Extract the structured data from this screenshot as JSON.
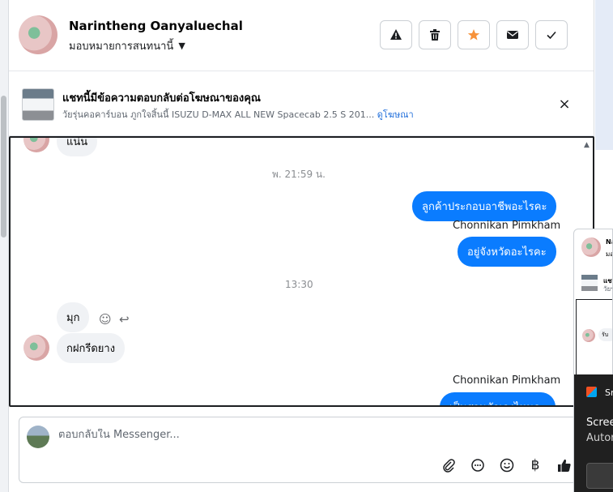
{
  "header": {
    "contact_name": "Narintheng Oanyaluechal",
    "assign_label": "มอบหมายการสนทนานี้",
    "buttons": [
      {
        "name": "report-button",
        "icon": "warning-icon"
      },
      {
        "name": "delete-button",
        "icon": "trash-icon"
      },
      {
        "name": "star-button",
        "icon": "star-icon",
        "color": "#f7923a"
      },
      {
        "name": "mark-unread-button",
        "icon": "envelope-icon"
      },
      {
        "name": "mark-done-button",
        "icon": "check-icon"
      }
    ]
  },
  "ad_banner": {
    "title": "แชทนี้มีข้อความตอบกลับต่อโฆษณาของคุณ",
    "subtitle": "วัยรุ่นคอคาร์บอน ภูกใจสิ้นนี้ ISUZU D-MAX ALL NEW Spacecab 2.5 S 201...",
    "link": "ดูโฆษณา",
    "close": "×"
  },
  "conversation": {
    "top_partial_message": "แน่น",
    "timestamp_1": "พ. 21:59 น.",
    "out_message_1": "ลูกค้าประกอบอาชีพอะไรคะ",
    "sender_1": "Chonnikan Pimkham",
    "out_message_2": "อยู่จังหวัดอะไรคะ",
    "timestamp_2": "13:30",
    "in_message_1": "มุก",
    "in_message_2": "กฝกรีดยาง",
    "sender_2": "Chonnikan Pimkham",
    "out_message_3_partial": "เป็นสวนตัวเองไหมคะ"
  },
  "composer": {
    "placeholder": "ตอบกลับใน Messenger...",
    "tools": [
      "paperclip-icon",
      "chat-bubble-icon",
      "emoji-icon",
      "baht-icon",
      "thumbs-up-icon"
    ]
  },
  "overlay": {
    "name_partial": "Na",
    "sub_partial": "มอ",
    "ad_partial": "แชท",
    "ad_sub_partial": "วัยรุ่",
    "bubble_partial": "รับ"
  },
  "toast": {
    "app_partial": "Sn",
    "title_partial": "Scree",
    "sub_partial": "Autor"
  },
  "colors": {
    "accent": "#0a7cff",
    "star": "#f7923a",
    "link": "#216fdb"
  }
}
